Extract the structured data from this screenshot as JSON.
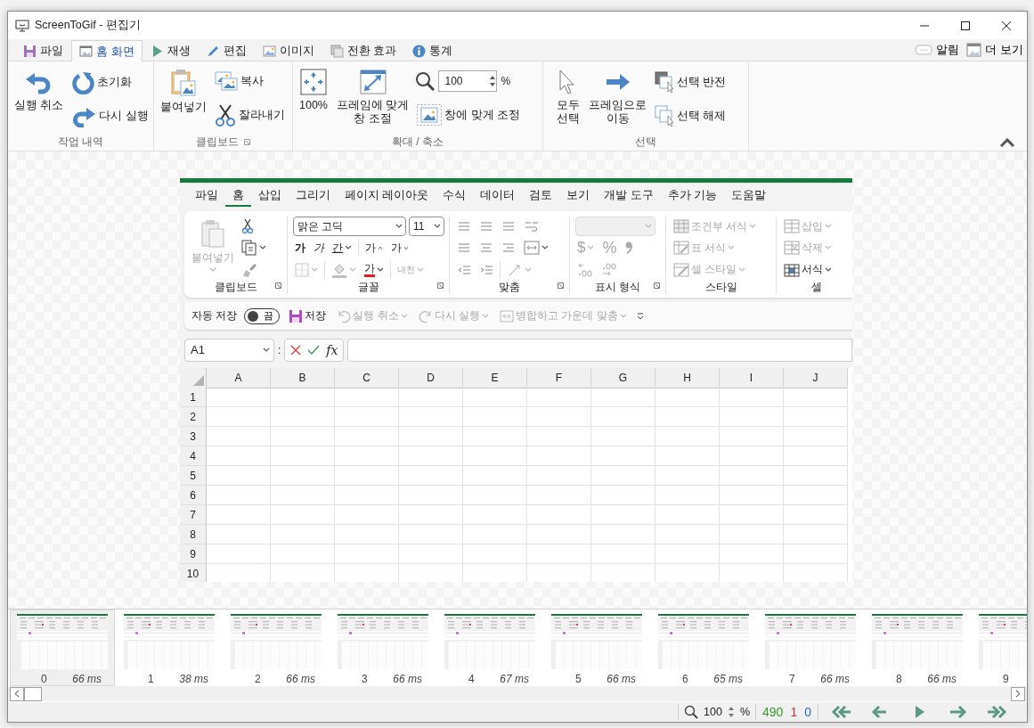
{
  "window": {
    "title": "ScreenToGif - 편집기"
  },
  "tabs": [
    {
      "label": "파일",
      "selected": false
    },
    {
      "label": "홈 화면",
      "selected": true
    },
    {
      "label": "재생",
      "selected": false
    },
    {
      "label": "편집",
      "selected": false
    },
    {
      "label": "이미지",
      "selected": false
    },
    {
      "label": "전환 효과",
      "selected": false
    },
    {
      "label": "통계",
      "selected": false
    }
  ],
  "header_buttons": [
    {
      "label": "알림"
    },
    {
      "label": "더 보기"
    }
  ],
  "ribbon": {
    "history": {
      "title": "작업 내역",
      "undo": "실행 취소",
      "reset": "초기화",
      "redo": "다시 실행"
    },
    "clipboard": {
      "title": "클립보드",
      "paste": "붙여넣기",
      "copy": "복사",
      "cut": "잘라내기"
    },
    "zoom": {
      "title": "확대 / 축소",
      "actual": "100%",
      "fit_window": "프레임에 맞게\n창 조절",
      "zoom_value": "100",
      "unit": "%",
      "fit_image": "창에 맞게 조정"
    },
    "selection": {
      "title": "선택",
      "select_all": "모두\n선택",
      "go_to": "프레임으로\n이동",
      "invert": "선택 반전",
      "deselect": "선택 해제"
    }
  },
  "excel": {
    "menu": [
      {
        "label": "파일",
        "selected": false
      },
      {
        "label": "홈",
        "selected": true
      },
      {
        "label": "삽입",
        "selected": false
      },
      {
        "label": "그리기",
        "selected": false
      },
      {
        "label": "페이지 레이아웃",
        "selected": false
      },
      {
        "label": "수식",
        "selected": false
      },
      {
        "label": "데이터",
        "selected": false
      },
      {
        "label": "검토",
        "selected": false
      },
      {
        "label": "보기",
        "selected": false
      },
      {
        "label": "개발 도구",
        "selected": false
      },
      {
        "label": "추가 기능",
        "selected": false
      },
      {
        "label": "도움말",
        "selected": false
      }
    ],
    "clipboard": {
      "title": "클립보드",
      "paste": {
        "label": "붙여넣기",
        "disabled": true
      }
    },
    "font": {
      "title": "글꼴",
      "font_name": "맑은 고딕",
      "font_size": "11",
      "bold": "가",
      "italic": "가",
      "underline": "간",
      "grow": "가",
      "shrink": "가",
      "color_letter": "가",
      "phonetic": "내천"
    },
    "alignment": {
      "title": "맞춤"
    },
    "number": {
      "title": "표시 형식",
      "currency": "$",
      "percent": "%"
    },
    "styles": {
      "title": "스타일",
      "items": [
        {
          "label": "조건부 서식",
          "disabled": true
        },
        {
          "label": "표 서식",
          "disabled": true
        },
        {
          "label": "셀 스타일",
          "disabled": true
        }
      ]
    },
    "cells": {
      "title": "셀",
      "items": [
        {
          "label": "삽입",
          "disabled": true
        },
        {
          "label": "삭제",
          "disabled": true
        },
        {
          "label": "서식",
          "disabled": false
        }
      ]
    },
    "quick_access": {
      "autosave_label": "자동 저장",
      "autosave": {
        "on": false,
        "label": "끔"
      },
      "save": "저장",
      "undo": {
        "label": "실행 취소",
        "disabled": true
      },
      "redo": {
        "label": "다시 실행",
        "disabled": true
      },
      "merge": {
        "label": "병합하고 가운데 맞춤",
        "disabled": true
      }
    },
    "formula_bar": {
      "name_box": "A1",
      "separator": ":",
      "fx": "fx"
    },
    "columns": [
      "A",
      "B",
      "C",
      "D",
      "E",
      "F",
      "G",
      "H",
      "I",
      "J"
    ],
    "rows": [
      "1",
      "2",
      "3",
      "4",
      "5",
      "6",
      "7",
      "8",
      "9",
      "10"
    ]
  },
  "frames": [
    {
      "number": "0",
      "delay": "66 ms",
      "selected": true
    },
    {
      "number": "1",
      "delay": "38 ms",
      "selected": false
    },
    {
      "number": "2",
      "delay": "66 ms",
      "selected": false
    },
    {
      "number": "3",
      "delay": "66 ms",
      "selected": false
    },
    {
      "number": "4",
      "delay": "67 ms",
      "selected": false
    },
    {
      "number": "5",
      "delay": "66 ms",
      "selected": false
    },
    {
      "number": "6",
      "delay": "65 ms",
      "selected": false
    },
    {
      "number": "7",
      "delay": "66 ms",
      "selected": false
    },
    {
      "number": "8",
      "delay": "66 ms",
      "selected": false
    },
    {
      "number": "9",
      "selected": false
    }
  ],
  "status": {
    "zoom": "100",
    "unit": "%",
    "counts": [
      {
        "value": "490",
        "color": "#3a9a2a"
      },
      {
        "value": "1",
        "color": "#d83030"
      },
      {
        "value": "0",
        "color": "#2a6fd0"
      }
    ]
  }
}
